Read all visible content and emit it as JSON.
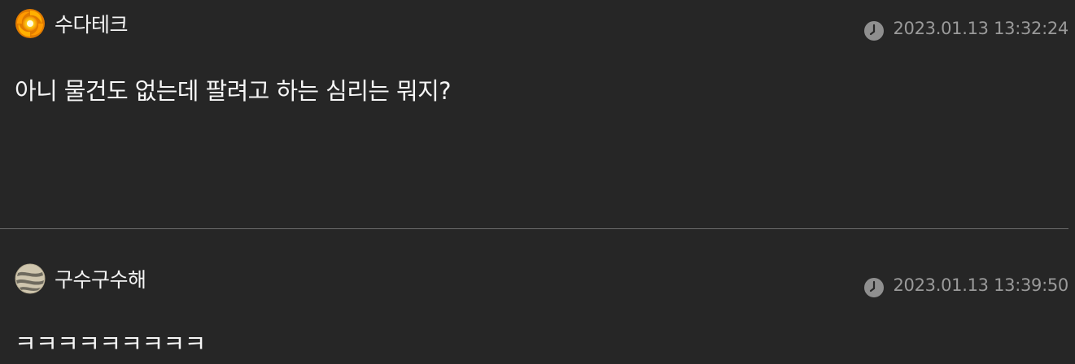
{
  "comments": [
    {
      "author": "수다테크",
      "avatar_icon": "sun-swirl-avatar-icon",
      "timestamp": "2023.01.13 13:32:24",
      "text": "아니 물건도 없는데 팔려고 하는 심리는 뭐지?"
    },
    {
      "author": "구수구수해",
      "avatar_icon": "striped-moon-avatar-icon",
      "timestamp": "2023.01.13 13:39:50",
      "text": "ㅋㅋㅋㅋㅋㅋㅋㅋㅋ"
    }
  ],
  "colors": {
    "background": "#262626",
    "text": "#f2f2f2",
    "timestamp": "#9a9a9a",
    "divider": "#6a6a6a",
    "accent_orange": "#f5a310"
  }
}
